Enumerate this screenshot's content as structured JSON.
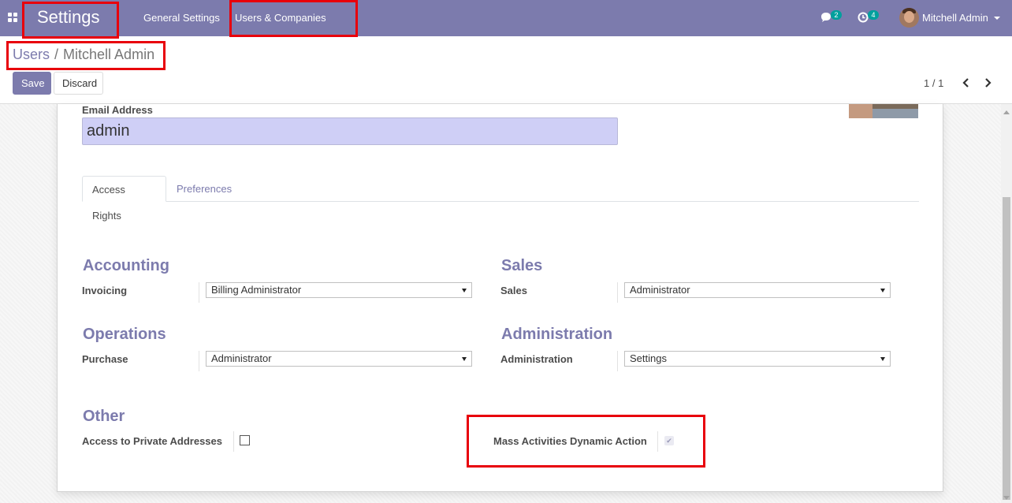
{
  "navbar": {
    "brand": "Settings",
    "menu": [
      "General Settings",
      "Users & Companies"
    ],
    "chat_badge": "2",
    "activity_badge": "4",
    "user_name": "Mitchell Admin",
    "bg_color": "#7c7bad"
  },
  "breadcrumb": {
    "parent": "Users",
    "separator": "/",
    "current": "Mitchell Admin"
  },
  "toolbar": {
    "save_label": "Save",
    "discard_label": "Discard",
    "pager": "1 / 1"
  },
  "form": {
    "email_label": "Email Address",
    "email_value": "admin",
    "tabs": [
      "Access Rights",
      "Preferences"
    ],
    "groups": {
      "accounting": {
        "title": "Accounting",
        "field_label": "Invoicing",
        "field_value": "Billing Administrator"
      },
      "sales": {
        "title": "Sales",
        "field_label": "Sales",
        "field_value": "Administrator"
      },
      "operations": {
        "title": "Operations",
        "field_label": "Purchase",
        "field_value": "Administrator"
      },
      "administration": {
        "title": "Administration",
        "field_label": "Administration",
        "field_value": "Settings"
      },
      "other": {
        "title": "Other",
        "private_addresses_label": "Access to Private Addresses",
        "private_addresses_checked": false,
        "mass_activities_label": "Mass Activities Dynamic Action",
        "mass_activities_checked": true
      }
    }
  },
  "accent_color": "#7c7bad",
  "highlight_color": "#e8000b",
  "icons": [
    "apps-icon",
    "chat-icon",
    "activity-clock-icon",
    "chevron-down-icon",
    "chevron-left-icon",
    "chevron-right-icon",
    "check-icon"
  ]
}
